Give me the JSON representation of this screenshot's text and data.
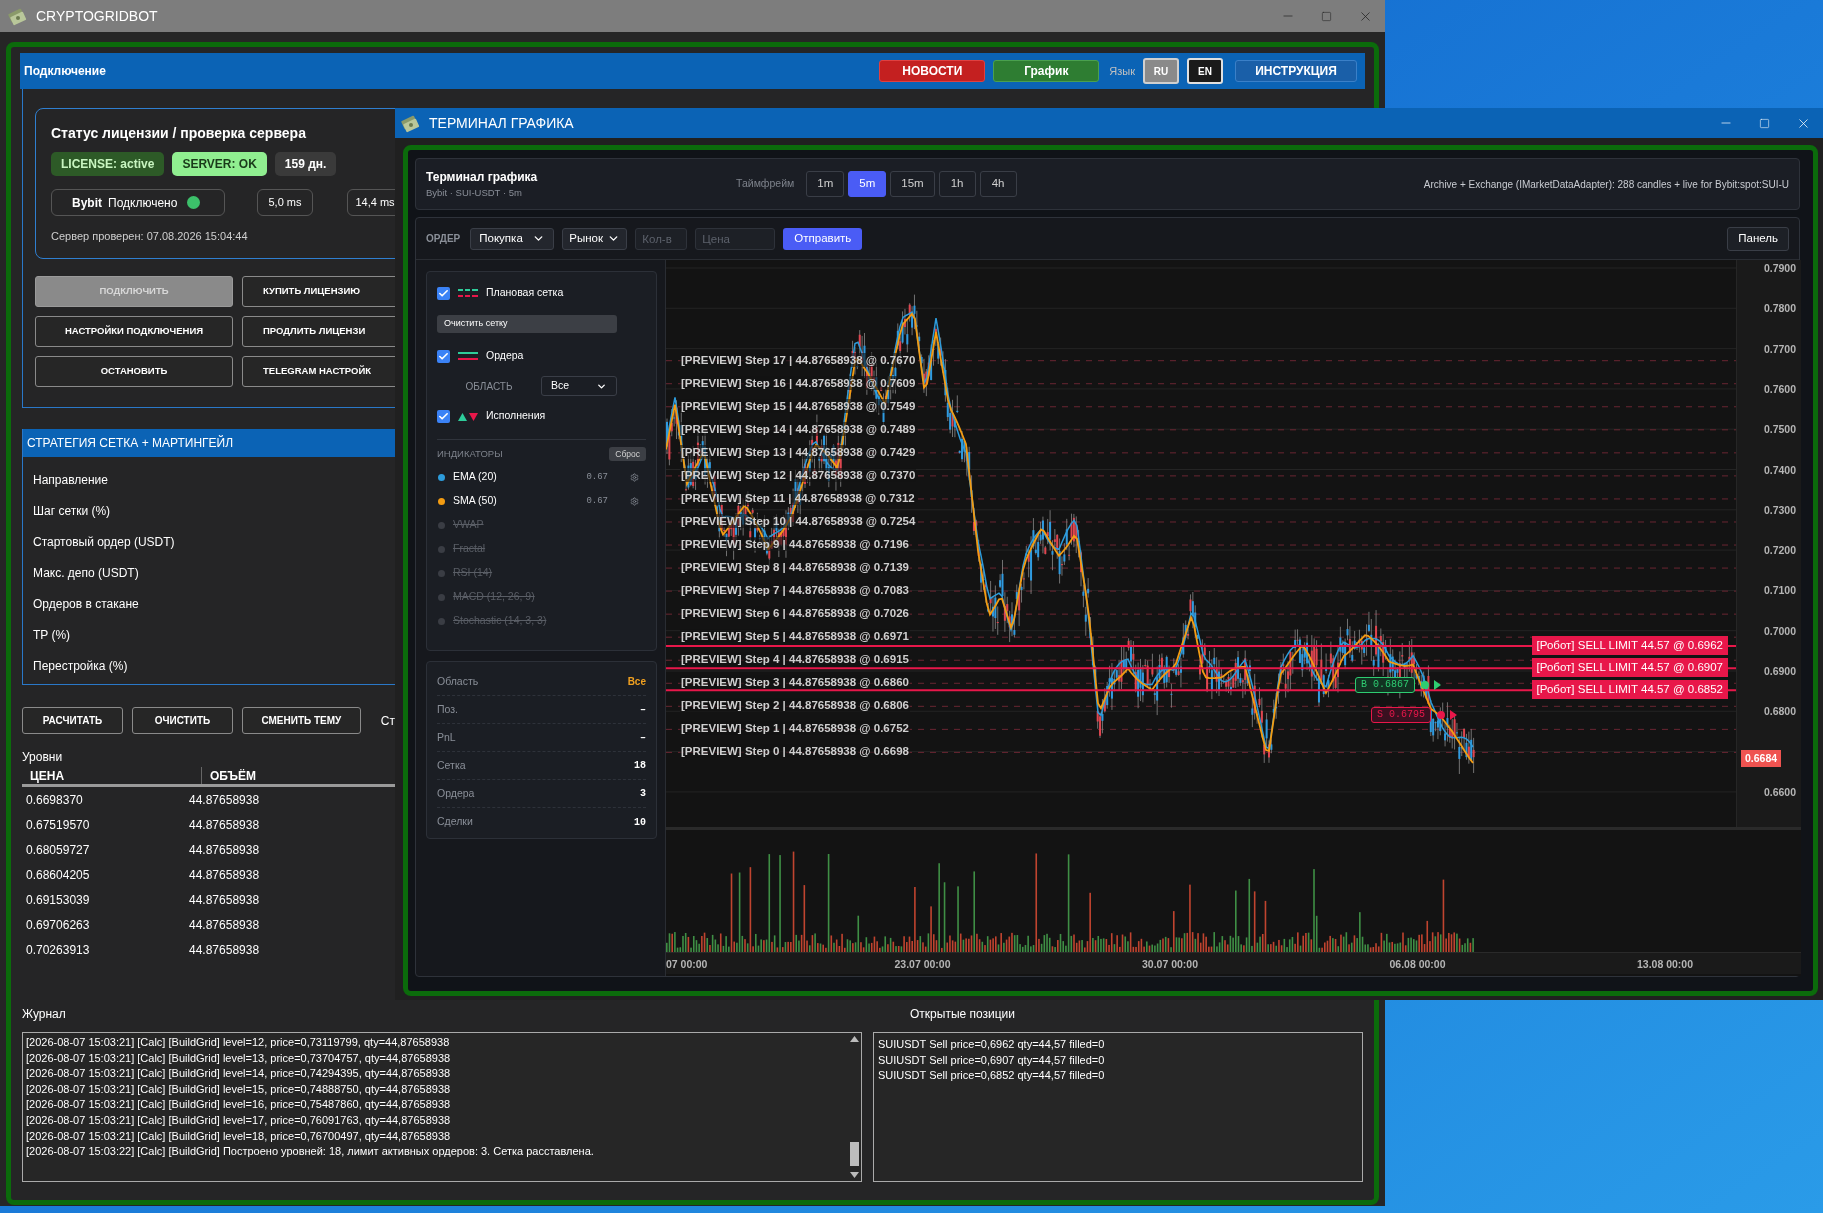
{
  "main_window": {
    "title": "CRYPTOGRIDBOT",
    "header": {
      "title": "Подключение",
      "buttons": [
        {
          "kind": "news",
          "label": "НОВОСТИ"
        },
        {
          "kind": "chart",
          "label": "График"
        }
      ],
      "language_label": "Язык",
      "languages": [
        {
          "label": "RU",
          "selected": true
        },
        {
          "label": "EN",
          "selected": false
        }
      ],
      "guide_button": "ИНСТРУКЦИЯ"
    },
    "license": {
      "title": "Статус лицензии / проверка сервера",
      "badges": [
        {
          "kind": "license",
          "text": "LICENSE: active"
        },
        {
          "kind": "server",
          "text": "SERVER: OK"
        },
        {
          "kind": "days",
          "text": "159 дн."
        }
      ],
      "exchange": {
        "name": "Bybit",
        "status": "Подключено",
        "connected": true
      },
      "latencies": [
        "5,0 ms",
        "14,4 ms"
      ],
      "checked_at": "Сервер проверен: 07.08.2026 15:04:44"
    },
    "buttons": [
      {
        "label": "ПОДКЛЮЧИТЬ",
        "disabled": true
      },
      {
        "label": "КУПИТЬ ЛИЦЕНЗИЮ",
        "disabled": false
      },
      {
        "label": "НАСТРОЙКИ ПОДКЛЮЧЕНИЯ",
        "disabled": false
      },
      {
        "label": "ПРОДЛИТЬ ЛИЦЕНЗИ",
        "disabled": false
      },
      {
        "label": "ОСТАНОВИТЬ",
        "disabled": false
      },
      {
        "label": "TELEGRAM НАСТРОЙК",
        "disabled": false
      }
    ],
    "strategy": {
      "title": "СТРАТЕГИЯ СЕТКА + МАРТИНГЕЙЛ",
      "fields": [
        "Направление",
        "Шаг сетки (%)",
        "Стартовый ордер (USDT)",
        "Макс. депо (USDT)",
        "Ордеров в стакане",
        "TP (%)",
        "Перестройка (%)"
      ]
    },
    "actions": [
      "РАСЧИТАТЬ",
      "ОЧИСТИТЬ",
      "СМЕНИТЬ ТЕМУ"
    ],
    "action_note": "Ст",
    "levels": {
      "title": "Уровни",
      "columns": [
        "ЦЕНА",
        "ОБЪЁМ"
      ],
      "rows": [
        [
          "0.6698370",
          "44.87658938"
        ],
        [
          "0.67519570",
          "44.87658938"
        ],
        [
          "0.68059727",
          "44.87658938"
        ],
        [
          "0.68604205",
          "44.87658938"
        ],
        [
          "0.69153039",
          "44.87658938"
        ],
        [
          "0.69706263",
          "44.87658938"
        ],
        [
          "0.70263913",
          "44.87658938"
        ]
      ]
    },
    "journal": {
      "title": "Журнал",
      "lines": [
        "[2026-08-07 15:03:21] [Calc] [BuildGrid] level=12, price=0,73119799, qty=44,87658938",
        "[2026-08-07 15:03:21] [Calc] [BuildGrid] level=13, price=0,73704757, qty=44,87658938",
        "[2026-08-07 15:03:21] [Calc] [BuildGrid] level=14, price=0,74294395, qty=44,87658938",
        "[2026-08-07 15:03:21] [Calc] [BuildGrid] level=15, price=0,74888750, qty=44,87658938",
        "[2026-08-07 15:03:21] [Calc] [BuildGrid] level=16, price=0,75487860, qty=44,87658938",
        "[2026-08-07 15:03:21] [Calc] [BuildGrid] level=17, price=0,76091763, qty=44,87658938",
        "[2026-08-07 15:03:21] [Calc] [BuildGrid] level=18, price=0,76700497, qty=44,87658938",
        "[2026-08-07 15:03:22] [Calc] [BuildGrid] Построено уровней: 18, лимит активных ордеров: 3. Сетка расставлена."
      ]
    },
    "positions": {
      "title": "Открытые позиции",
      "lines": [
        "SUIUSDT Sell price=0,6962 qty=44,57 filled=0",
        "SUIUSDT Sell price=0,6907 qty=44,57 filled=0",
        "SUIUSDT Sell price=0,6852 qty=44,57 filled=0"
      ]
    }
  },
  "chart_window": {
    "title": "ТЕРМИНАЛ ГРАФИКА",
    "header": {
      "title": "Терминал графика",
      "subtitle": "Bybit · SUI-USDT · 5m",
      "timeframe_label": "Таймфрейм",
      "timeframes": [
        {
          "label": "1m",
          "selected": false
        },
        {
          "label": "5m",
          "selected": true
        },
        {
          "label": "15m",
          "selected": false
        },
        {
          "label": "1h",
          "selected": false
        },
        {
          "label": "4h",
          "selected": false
        }
      ],
      "source": "Archive + Exchange (IMarketDataAdapter): 288 candles + live for Bybit:spot:SUI-U"
    },
    "order_bar": {
      "label": "ОРДЕР",
      "side": "Покупка",
      "type": "Рынок",
      "qty_placeholder": "Кол-в",
      "price_placeholder": "Цена",
      "submit": "Отправить",
      "panel_button": "Панель"
    },
    "layers": [
      {
        "kind": "grid",
        "label": "Плановая сетка",
        "checked": true
      },
      {
        "kind": "orders",
        "label": "Ордера",
        "checked": true
      },
      {
        "kind": "fills",
        "label": "Исполнения",
        "checked": true
      }
    ],
    "clear_grid_button": "Очистить сетку",
    "area_filter": {
      "label": "ОБЛАСТЬ",
      "value": "Все"
    },
    "indicators_title": "ИНДИКАТОРЫ",
    "reset_button": "Сброс",
    "indicators": [
      {
        "name": "EMA (20)",
        "value": "0.67",
        "enabled": true,
        "color": "#2d9cdb"
      },
      {
        "name": "SMA (50)",
        "value": "0.67",
        "enabled": true,
        "color": "#f39c12"
      },
      {
        "name": "VWAP",
        "enabled": false,
        "color": "#3a3d44"
      },
      {
        "name": "Fractal",
        "enabled": false,
        "color": "#3a3d44"
      },
      {
        "name": "RSI (14)",
        "enabled": false,
        "color": "#3a3d44"
      },
      {
        "name": "MACD (12, 26, 9)",
        "enabled": false,
        "color": "#3a3d44"
      },
      {
        "name": "Stochastic (14, 3, 3)",
        "enabled": false,
        "color": "#3a3d44"
      }
    ],
    "stats": [
      {
        "kind": "filter",
        "label": "Область",
        "value": "Все"
      },
      {
        "kind": "count",
        "label": "Поз.",
        "value": "–"
      },
      {
        "kind": "count",
        "label": "PnL",
        "value": "–"
      },
      {
        "kind": "count",
        "label": "Сетка",
        "value": "18"
      },
      {
        "kind": "count",
        "label": "Ордера",
        "value": "3"
      },
      {
        "kind": "count",
        "label": "Сделки",
        "value": "10"
      }
    ],
    "grid_preview": [
      "[PREVIEW] Step 17 | 44.87658938 @ 0.7670",
      "[PREVIEW] Step 16 | 44.87658938 @ 0.7609",
      "[PREVIEW] Step 15 | 44.87658938 @ 0.7549",
      "[PREVIEW] Step 14 | 44.87658938 @ 0.7489",
      "[PREVIEW] Step 13 | 44.87658938 @ 0.7429",
      "[PREVIEW] Step 12 | 44.87658938 @ 0.7370",
      "[PREVIEW] Step 11 | 44.87658938 @ 0.7312",
      "[PREVIEW] Step 10 | 44.87658938 @ 0.7254",
      "[PREVIEW] Step 9 | 44.87658938 @ 0.7196",
      "[PREVIEW] Step 8 | 44.87658938 @ 0.7139",
      "[PREVIEW] Step 7 | 44.87658938 @ 0.7083",
      "[PREVIEW] Step 6 | 44.87658938 @ 0.7026",
      "[PREVIEW] Step 5 | 44.87658938 @ 0.6971",
      "[PREVIEW] Step 4 | 44.87658938 @ 0.6915",
      "[PREVIEW] Step 3 | 44.87658938 @ 0.6860",
      "[PREVIEW] Step 2 | 44.87658938 @ 0.6806",
      "[PREVIEW] Step 1 | 44.87658938 @ 0.6752",
      "[PREVIEW] Step 0 | 44.87658938 @ 0.6698"
    ],
    "orders": [
      "[Робот] SELL LIMIT 44.57 @ 0.6962",
      "[Робот] SELL LIMIT 44.57 @ 0.6907",
      "[Робот] SELL LIMIT 44.57 @ 0.6852"
    ],
    "trade_markers": [
      {
        "kind": "buy",
        "label": "B 0.6867"
      },
      {
        "kind": "sell",
        "label": "S 0.6795"
      }
    ],
    "price_axis": [
      "0.7900",
      "0.7800",
      "0.7700",
      "0.7600",
      "0.7500",
      "0.7400",
      "0.7300",
      "0.7200",
      "0.7100",
      "0.7000",
      "0.6900",
      "0.6800",
      "0.6600"
    ],
    "last_price": "0.6684",
    "time_axis": [
      "07 00:00",
      "23.07 00:00",
      "30.07 00:00",
      "06.08 00:00",
      "13.08 00:00"
    ]
  }
}
